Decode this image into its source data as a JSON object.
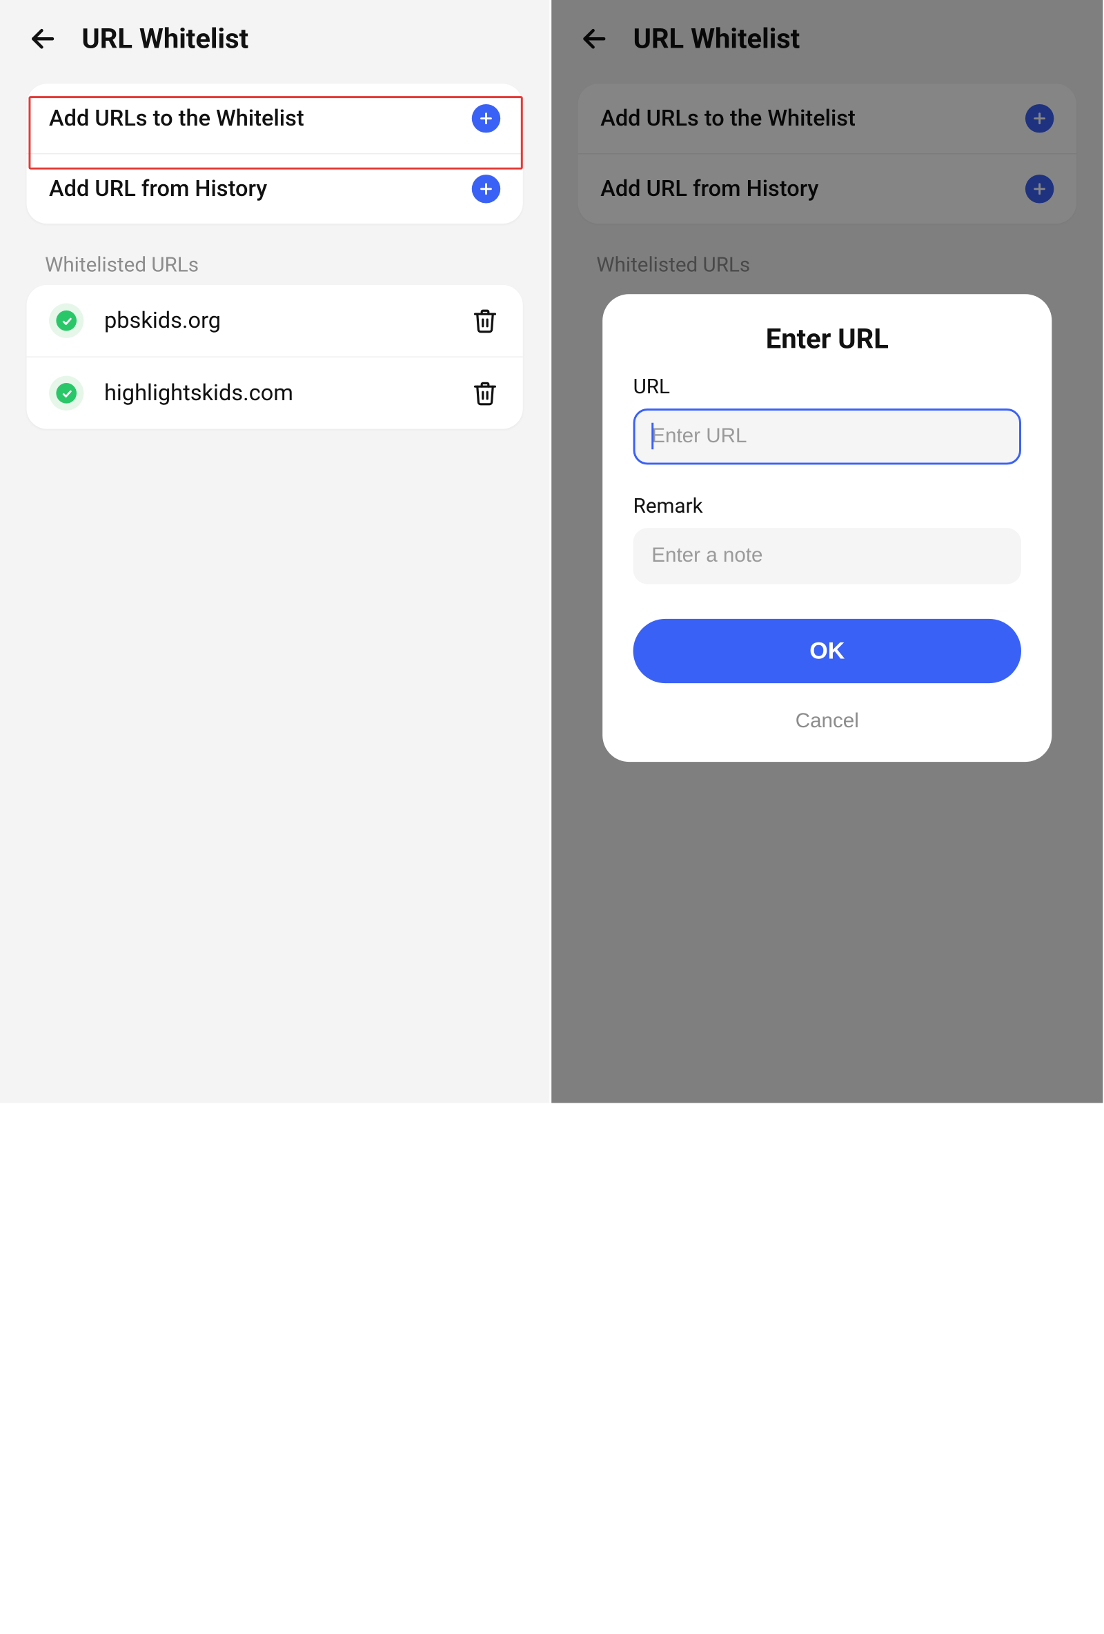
{
  "colors": {
    "accent": "#3a61f6",
    "success": "#2ac769",
    "highlight": "#e53935"
  },
  "left": {
    "header": {
      "title": "URL Whitelist"
    },
    "actions": {
      "add_to_whitelist": "Add URLs to the Whitelist",
      "add_from_history": "Add URL from History"
    },
    "section_label": "Whitelisted URLs",
    "urls": [
      {
        "domain": "pbskids.org"
      },
      {
        "domain": "highlightskids.com"
      }
    ]
  },
  "right": {
    "header": {
      "title": "URL Whitelist"
    },
    "actions": {
      "add_to_whitelist": "Add URLs to the Whitelist",
      "add_from_history": "Add URL from History"
    },
    "section_label": "Whitelisted URLs",
    "modal": {
      "title": "Enter URL",
      "url_label": "URL",
      "url_placeholder": "Enter URL",
      "url_value": "",
      "remark_label": "Remark",
      "remark_placeholder": "Enter a note",
      "remark_value": "",
      "ok": "OK",
      "cancel": "Cancel"
    }
  }
}
